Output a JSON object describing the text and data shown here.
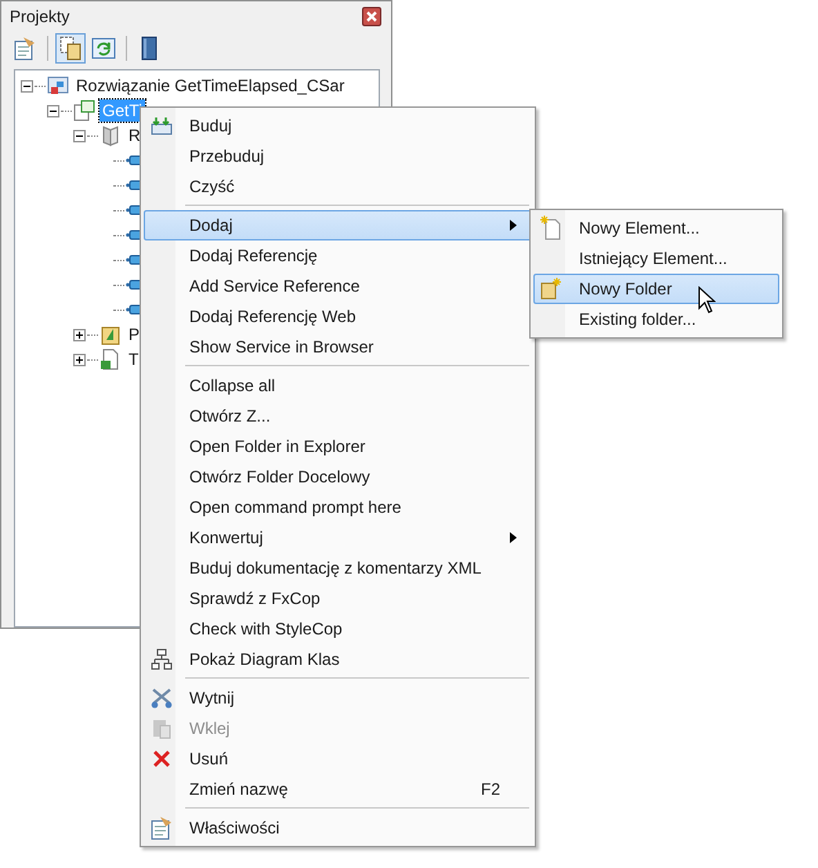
{
  "panel": {
    "title": "Projekty",
    "toolbar": [
      {
        "kind": "properties",
        "selected": false
      },
      {
        "kind": "show-all",
        "selected": true
      },
      {
        "kind": "refresh",
        "selected": false
      },
      {
        "kind": "book",
        "selected": false
      }
    ],
    "tree": [
      {
        "label": "Rozwiązanie GetTimeElapsed_CSar",
        "kind": "solution",
        "expanded": true,
        "selected": false,
        "children": [
          {
            "label": "GetTi",
            "kind": "project",
            "expanded": true,
            "selected": true,
            "children": [
              {
                "label": "R",
                "kind": "references",
                "expanded": true,
                "selected": false,
                "children": [
                  {
                    "kind": "reference",
                    "selected": false
                  },
                  {
                    "kind": "reference",
                    "selected": false
                  },
                  {
                    "kind": "reference",
                    "selected": false
                  },
                  {
                    "kind": "reference",
                    "selected": false
                  },
                  {
                    "kind": "reference",
                    "selected": false
                  },
                  {
                    "kind": "reference",
                    "selected": false
                  },
                  {
                    "kind": "reference",
                    "selected": false
                  }
                ]
              },
              {
                "label": "P",
                "kind": "properties",
                "expanded": false,
                "selected": false
              },
              {
                "label": "T",
                "kind": "csfile",
                "expanded": false,
                "selected": false
              }
            ]
          }
        ]
      }
    ]
  },
  "context_menu": [
    {
      "kind": "item",
      "label": "Buduj",
      "selected": false,
      "disabled": false
    },
    {
      "kind": "item",
      "label": "Przebuduj",
      "selected": false,
      "disabled": false
    },
    {
      "kind": "item",
      "label": "Czyść",
      "selected": false,
      "disabled": false
    },
    {
      "kind": "separator"
    },
    {
      "kind": "item",
      "label": "Dodaj",
      "selected": true,
      "disabled": false,
      "submenu": true
    },
    {
      "kind": "item",
      "label": "Dodaj Referencję",
      "selected": false,
      "disabled": false
    },
    {
      "kind": "item",
      "label": "Add Service Reference",
      "selected": false,
      "disabled": false
    },
    {
      "kind": "item",
      "label": "Dodaj Referencję Web",
      "selected": false,
      "disabled": false
    },
    {
      "kind": "item",
      "label": "Show Service in Browser",
      "selected": false,
      "disabled": false
    },
    {
      "kind": "separator"
    },
    {
      "kind": "item",
      "label": "Collapse all",
      "selected": false,
      "disabled": false
    },
    {
      "kind": "item",
      "label": "Otwórz Z...",
      "selected": false,
      "disabled": false
    },
    {
      "kind": "item",
      "label": "Open Folder in Explorer",
      "selected": false,
      "disabled": false
    },
    {
      "kind": "item",
      "label": "Otwórz Folder Docelowy",
      "selected": false,
      "disabled": false
    },
    {
      "kind": "item",
      "label": "Open command prompt here",
      "selected": false,
      "disabled": false
    },
    {
      "kind": "item",
      "label": "Konwertuj",
      "selected": false,
      "disabled": false,
      "submenu": true
    },
    {
      "kind": "item",
      "label": "Buduj dokumentację z komentarzy XML",
      "selected": false,
      "disabled": false
    },
    {
      "kind": "item",
      "label": "Sprawdź z FxCop",
      "selected": false,
      "disabled": false
    },
    {
      "kind": "item",
      "label": "Check with StyleCop",
      "selected": false,
      "disabled": false
    },
    {
      "kind": "item",
      "label": "Pokaż Diagram Klas",
      "selected": false,
      "disabled": false
    },
    {
      "kind": "separator"
    },
    {
      "kind": "item",
      "label": "Wytnij",
      "selected": false,
      "disabled": false
    },
    {
      "kind": "item",
      "label": "Wklej",
      "selected": false,
      "disabled": true
    },
    {
      "kind": "item",
      "label": "Usuń",
      "selected": false,
      "disabled": false
    },
    {
      "kind": "item",
      "label": "Zmień nazwę",
      "shortcut": "F2",
      "selected": false,
      "disabled": false
    },
    {
      "kind": "separator"
    },
    {
      "kind": "item",
      "label": "Właściwości",
      "selected": false,
      "disabled": false
    }
  ],
  "submenu": [
    {
      "label": "Nowy Element...",
      "selected": false
    },
    {
      "label": "Istniejący Element...",
      "selected": false
    },
    {
      "label": "Nowy Folder",
      "selected": true
    },
    {
      "label": "Existing folder...",
      "selected": false
    }
  ]
}
